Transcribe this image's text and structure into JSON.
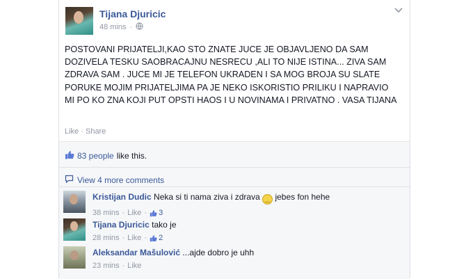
{
  "post": {
    "author": "Tijana Djuricic",
    "time": "48 mins",
    "separator": "·",
    "text": "POSTOVANI PRIJATELJI,KAO STO ZNATE JUCE JE OBJAVLJENO DA SAM DOZIVELA TESKU SAOBRACAJNU NESRECU ,ALI TO NIJE ISTINA... ZIVA SAM ZDRAVA SAM . JUCE MI JE TELEFON UKRADEN I SA MOG BROJA SU SLATE PORUKE MOJIM PRIJATELJIMA PA JE NEKO ISKORISTIO PRILIKU I NAPRAVIO MI PO KO ZNA KOJI PUT OPSTI HAOS I U NOVINAMA I PRIVATNO . VASA TIJANA",
    "like_label": "Like",
    "dot": "·",
    "share_label": "Share"
  },
  "likes": {
    "count": "83 people",
    "suffix": "like this."
  },
  "more_comments": "View 4 more comments",
  "comments": [
    {
      "author": "Kristijan Dudic",
      "text": "Neka si ti nama ziva i zdrava",
      "text_after": "jebes fon hehe",
      "time": "38 mins",
      "like_label": "Like",
      "like_count": "3"
    },
    {
      "author": "Tijana Djuricic",
      "text": "tako je",
      "time": "28 mins",
      "like_label": "Like",
      "like_count": "2"
    },
    {
      "author": "Aleksandar Mašulović",
      "text": "...ajde dobro je uhh",
      "time": "23 mins",
      "like_label": "Like"
    }
  ],
  "colors": {
    "link": "#3b5998",
    "meta": "#9197a3",
    "feedback_bg": "#f6f7f9"
  },
  "icons": [
    "globe-icon",
    "chevron-down-icon",
    "thumbs-up-icon",
    "comment-icon",
    "smiley-icon"
  ]
}
